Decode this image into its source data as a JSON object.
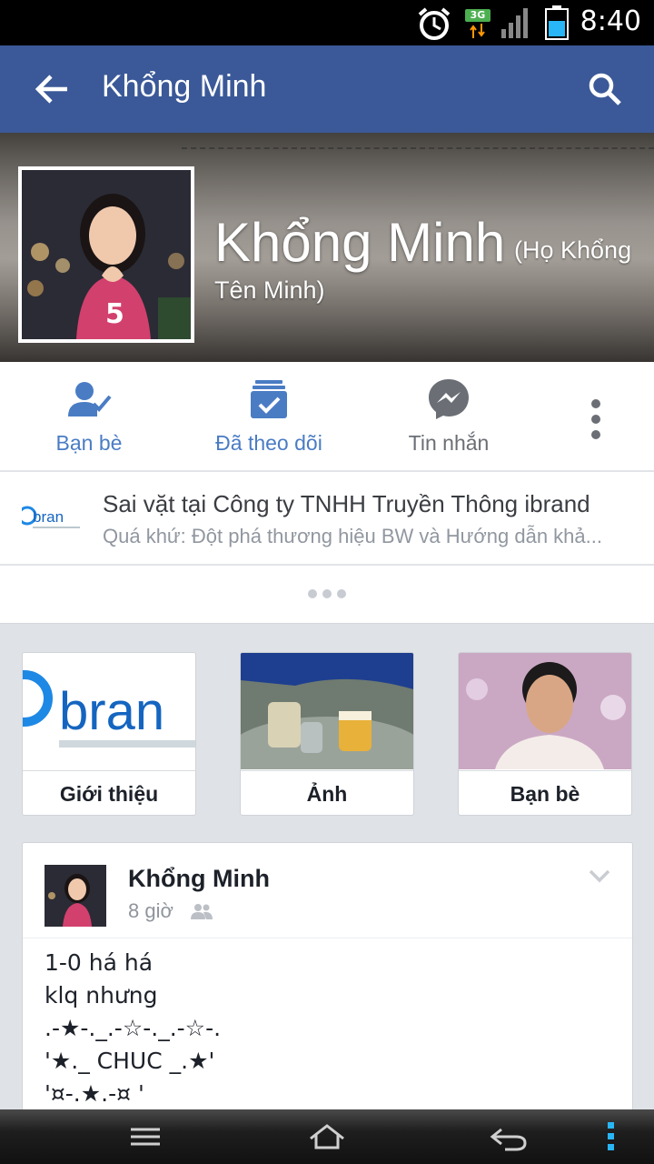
{
  "status_bar": {
    "time": "8:40",
    "network": "3G"
  },
  "app_bar": {
    "title": "Khổng Minh"
  },
  "profile": {
    "name": "Khổng Minh",
    "alt_name_1": "(Họ Khổng",
    "alt_name_2": "Tên Minh)"
  },
  "actions": [
    {
      "label": "Bạn bè",
      "icon": "friends-check-icon"
    },
    {
      "label": "Đã theo dõi",
      "icon": "following-icon"
    },
    {
      "label": "Tin nhắn",
      "icon": "messenger-icon"
    }
  ],
  "work": {
    "line1": "Sai vặt tại Công ty TNHH Truyền Thông ibrand",
    "line2": "Quá khứ: Đột phá thương hiệu BW và Hướng dẫn khả..."
  },
  "tiles": [
    {
      "label": "Giới thiệu"
    },
    {
      "label": "Ảnh"
    },
    {
      "label": "Bạn bè"
    }
  ],
  "post": {
    "author": "Khổng Minh",
    "time": "8 giờ",
    "lines": [
      "1-0 há há",
      "klq nhưng",
      ".-★-._.-☆-._.-☆-.",
      "'★._ CHUC _.★'",
      "'¤-.★.-¤ '"
    ]
  },
  "colors": {
    "brand_blue": "#3b5998",
    "action_blue": "#4a7cc4"
  }
}
